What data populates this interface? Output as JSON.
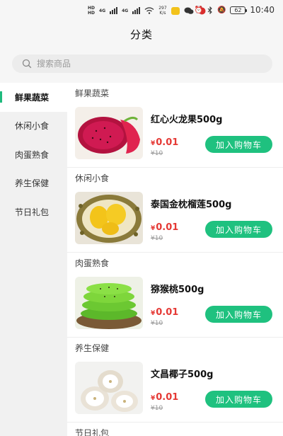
{
  "status_bar": {
    "hd_label": "HD",
    "signal_1_label": "4G",
    "signal_2_label": "4G",
    "net_speed": "297",
    "net_speed_unit": "K/s",
    "battery": "62",
    "time": "10:40"
  },
  "header": {
    "title": "分类"
  },
  "search": {
    "placeholder": "搜索商品"
  },
  "sidebar": {
    "items": [
      {
        "label": "鲜果蔬菜",
        "active": true
      },
      {
        "label": "休闲小食",
        "active": false
      },
      {
        "label": "肉蛋熟食",
        "active": false
      },
      {
        "label": "养生保健",
        "active": false
      },
      {
        "label": "节日礼包",
        "active": false
      }
    ]
  },
  "sections": [
    {
      "title": "鲜果蔬菜",
      "product": {
        "name": "红心火龙果500g",
        "price": "0.01",
        "currency": "¥",
        "original_price": "¥10",
        "button": "加入购物车",
        "image": "dragon-fruit"
      }
    },
    {
      "title": "休闲小食",
      "product": {
        "name": "泰国金枕榴莲500g",
        "price": "0.01",
        "currency": "¥",
        "original_price": "¥10",
        "button": "加入购物车",
        "image": "durian"
      }
    },
    {
      "title": "肉蛋熟食",
      "product": {
        "name": "猕猴桃500g",
        "price": "0.01",
        "currency": "¥",
        "original_price": "¥10",
        "button": "加入购物车",
        "image": "kiwi"
      }
    },
    {
      "title": "养生保健",
      "product": {
        "name": "文昌椰子500g",
        "price": "0.01",
        "currency": "¥",
        "original_price": "¥10",
        "button": "加入购物车",
        "image": "coconut"
      }
    },
    {
      "title": "节日礼包"
    }
  ],
  "colors": {
    "accent": "#1fc17f",
    "price": "#e53935",
    "indicator": "#1fba7d"
  }
}
